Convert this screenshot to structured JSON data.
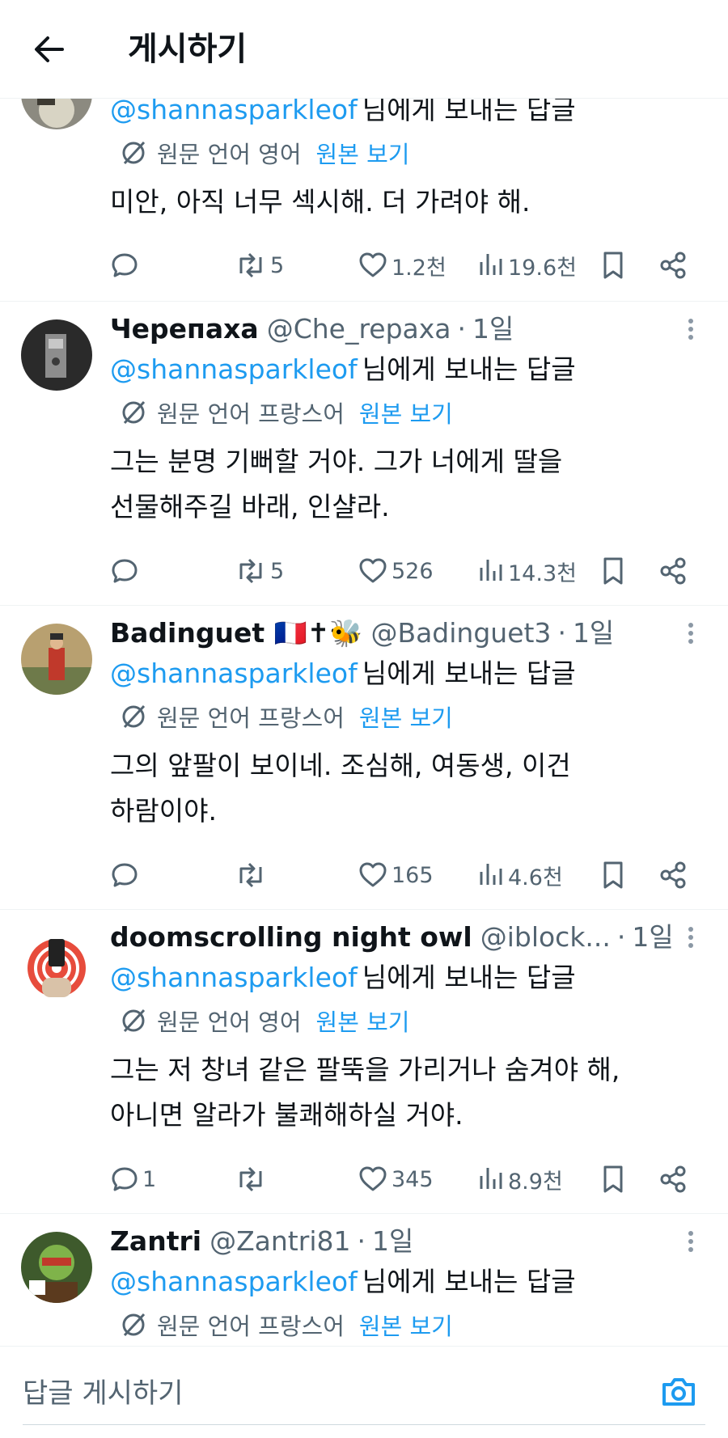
{
  "header": {
    "title": "게시하기"
  },
  "icons": {
    "back": "arrow-left-icon",
    "more": "more-dots-icon",
    "translate": "translate-icon",
    "camera": "camera-icon"
  },
  "colors": {
    "accent": "#1d9bf0",
    "secondary_text": "#536471",
    "text": "#0f1419",
    "divider": "#eff3f4"
  },
  "tweets": [
    {
      "reply_to": "@shannasparkleof",
      "reply_suffix": "님에게 보내는 답글",
      "translation": {
        "label": "원문 언어 영어",
        "show_original": "원본 보기"
      },
      "lines": [
        "미안, 아직 너무 섹시해. 더 가려야 해."
      ],
      "replies": "",
      "reposts": "5",
      "likes": "1.2천",
      "views": "19.6천"
    },
    {
      "display_name": "Черепаха",
      "handle": "@Che_repaxa",
      "dot": "·",
      "time": "1일",
      "reply_to": "@shannasparkleof",
      "reply_suffix": "님에게 보내는 답글",
      "translation": {
        "label": "원문 언어 프랑스어",
        "show_original": "원본 보기"
      },
      "lines": [
        "그는 분명 기뻐할 거야. 그가 너에게 딸을",
        "선물해주길 바래, 인샬라."
      ],
      "replies": "",
      "reposts": "5",
      "likes": "526",
      "views": "14.3천"
    },
    {
      "display_name": "Badinguet 🇫🇷✝🐝",
      "handle": "@Badinguet3",
      "dot": "·",
      "time": "1일",
      "reply_to": "@shannasparkleof",
      "reply_suffix": "님에게 보내는 답글",
      "translation": {
        "label": "원문 언어 프랑스어",
        "show_original": "원본 보기"
      },
      "lines": [
        "그의 앞팔이 보이네. 조심해, 여동생, 이건",
        "하람이야."
      ],
      "replies": "",
      "reposts": "",
      "likes": "165",
      "views": "4.6천"
    },
    {
      "display_name": "doomscrolling night owl",
      "handle": "@iblock...",
      "dot": "·",
      "time": "1일",
      "reply_to": "@shannasparkleof",
      "reply_suffix": "님에게 보내는 답글",
      "translation": {
        "label": "원문 언어 영어",
        "show_original": "원본 보기"
      },
      "lines": [
        "그는 저 창녀 같은 팔뚝을 가리거나 숨겨야 해,",
        "아니면 알라가 불쾌해하실 거야."
      ],
      "replies": "1",
      "reposts": "",
      "likes": "345",
      "views": "8.9천"
    },
    {
      "display_name": "Zantri",
      "handle": "@Zantri81",
      "dot": "·",
      "time": "1일",
      "reply_to": "@shannasparkleof",
      "reply_suffix": "님에게 보내는 답글",
      "translation": {
        "label": "원문 언어 프랑스어",
        "show_original": "원본 보기"
      }
    }
  ],
  "compose": {
    "placeholder": "답글 게시하기"
  }
}
